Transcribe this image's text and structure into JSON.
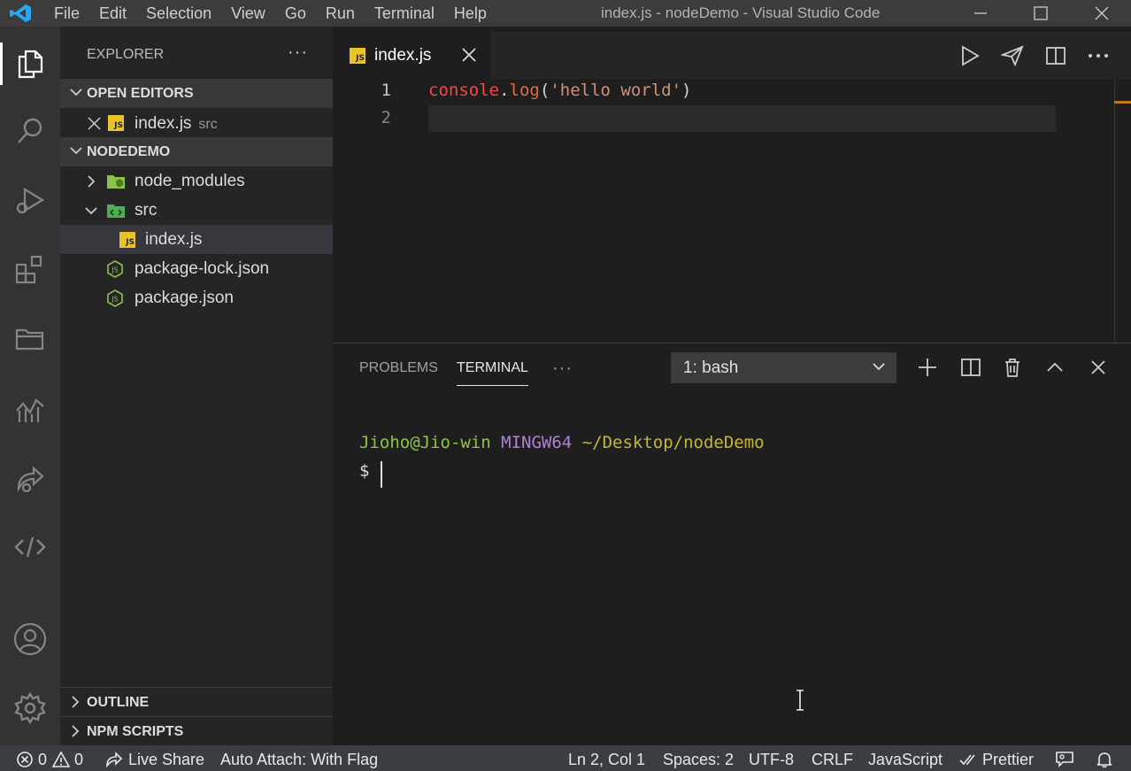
{
  "window": {
    "title": "index.js - nodeDemo - Visual Studio Code",
    "menus": [
      "File",
      "Edit",
      "Selection",
      "View",
      "Go",
      "Run",
      "Terminal",
      "Help"
    ]
  },
  "colors": {
    "accent": "#007acc",
    "js_badge": "#e8c32a",
    "node_green": "#8bc34a",
    "string": "#ce9178",
    "keyword_red": "#f44747"
  },
  "activity_bar": {
    "icons": [
      "files-icon",
      "search-icon",
      "run-debug-icon",
      "extensions-icon",
      "folder-icon",
      "analytics-icon",
      "live-share-icon",
      "code-icon",
      "account-icon",
      "gear-icon"
    ]
  },
  "sidebar": {
    "title": "EXPLORER",
    "open_editors": {
      "label": "OPEN EDITORS",
      "items": [
        {
          "name": "index.js",
          "folder": "src"
        }
      ]
    },
    "project": {
      "label": "NODEDEMO",
      "tree": [
        {
          "name": "node_modules",
          "type": "folder",
          "expanded": false
        },
        {
          "name": "src",
          "type": "folder",
          "expanded": true
        },
        {
          "name": "index.js",
          "type": "js",
          "selected": true
        },
        {
          "name": "package-lock.json",
          "type": "json"
        },
        {
          "name": "package.json",
          "type": "json"
        }
      ]
    },
    "outline_label": "OUTLINE",
    "npm_scripts_label": "NPM SCRIPTS"
  },
  "editor": {
    "tab_label": "index.js",
    "line_numbers": [
      "1",
      "2"
    ],
    "code": {
      "object": "console",
      "dot": ".",
      "method": "log",
      "open": "(",
      "string": "'hello world'",
      "close": ")"
    }
  },
  "panel": {
    "tabs": [
      "PROBLEMS",
      "TERMINAL"
    ],
    "active_tab": "TERMINAL",
    "more": "···",
    "terminal_select": "1: bash",
    "prompt": {
      "user": "Jioho@Jio-win",
      "system": "MINGW64",
      "path": "~/Desktop/nodeDemo",
      "symbol": "$"
    }
  },
  "statusbar": {
    "errors": "0",
    "warnings": "0",
    "live_share": "Live Share",
    "auto_attach": "Auto Attach: With Flag",
    "position": "Ln 2, Col 1",
    "spaces": "Spaces: 2",
    "encoding": "UTF-8",
    "eol": "CRLF",
    "language": "JavaScript",
    "prettier": "Prettier"
  }
}
